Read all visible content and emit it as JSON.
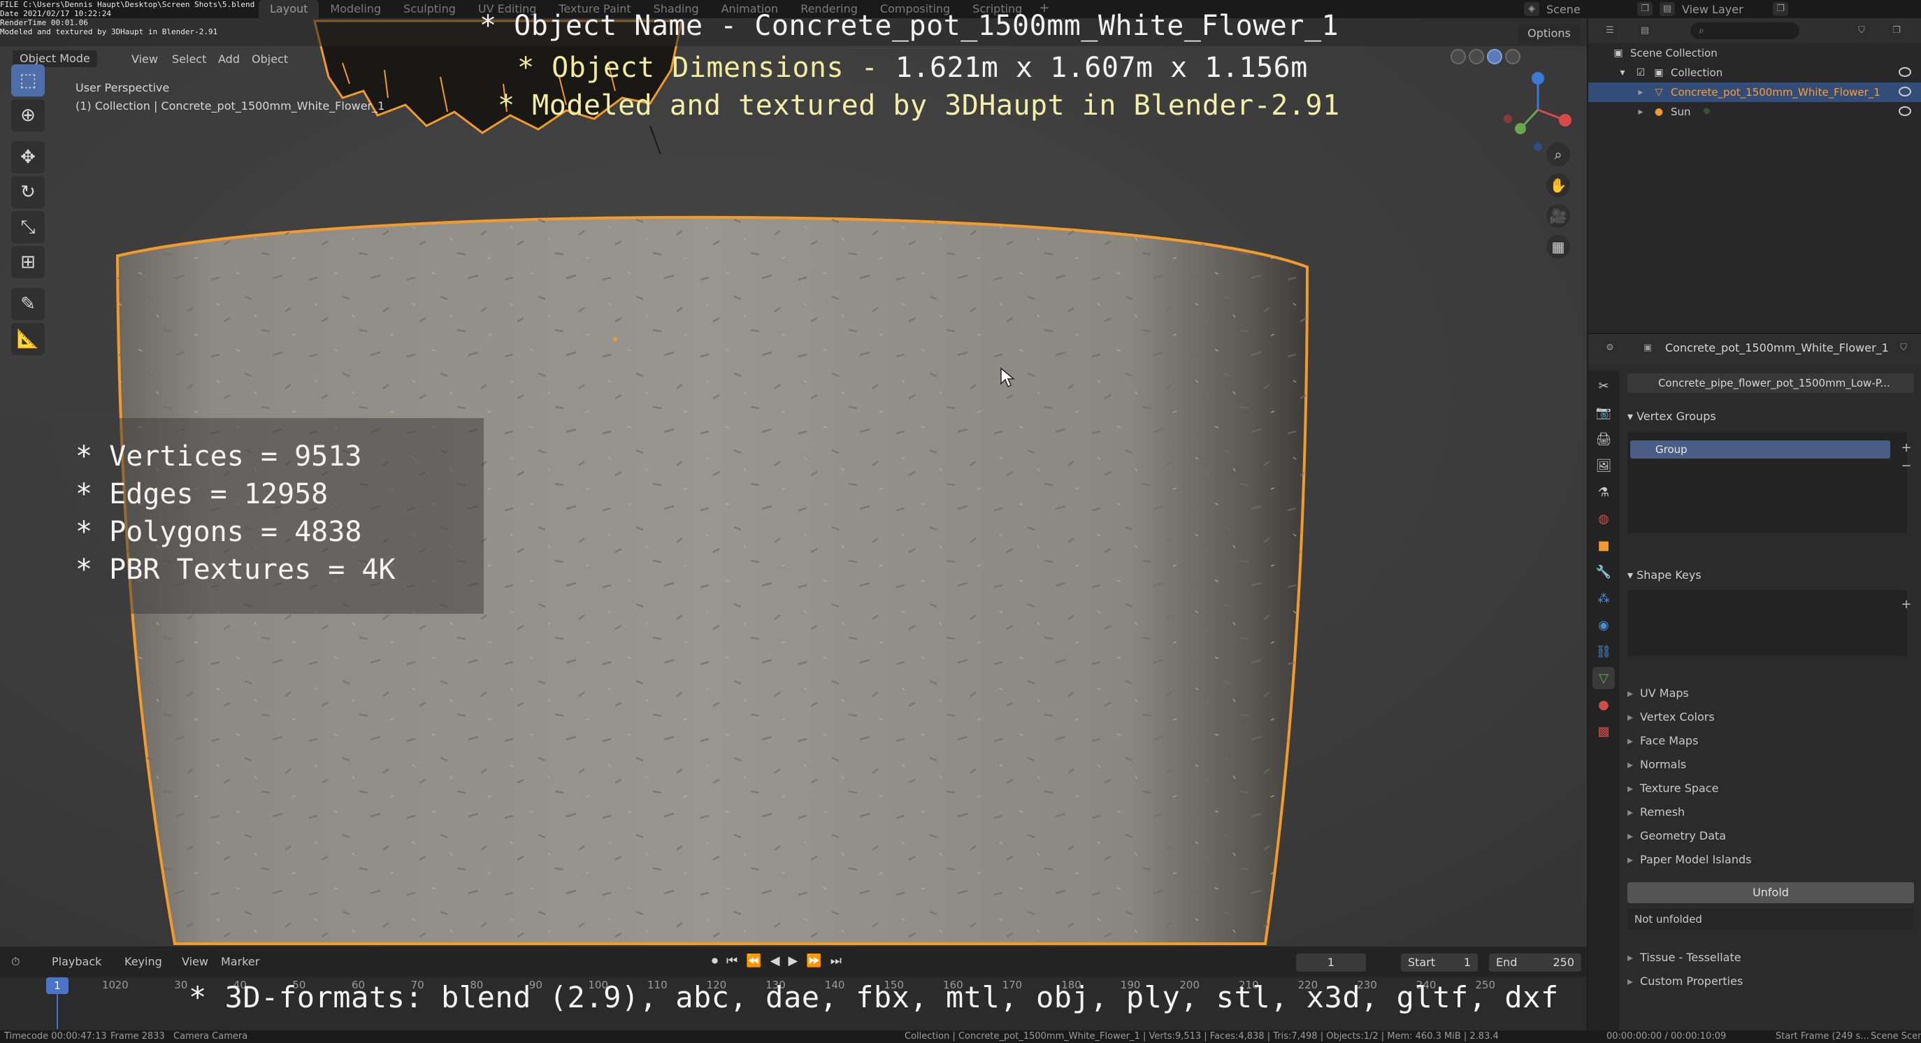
{
  "file_info": [
    "FILE C:\\Users\\Dennis Haupt\\Desktop\\Screen Shots\\5.blend",
    "Date 2021/02/17 10:22:24",
    "RenderTime 00:01.06",
    "Modeled and textured by 3DHaupt in Blender-2.91"
  ],
  "workspace_tabs": [
    "Layout",
    "Modeling",
    "Sculpting",
    "UV Editing",
    "Texture Paint",
    "Shading",
    "Animation",
    "Rendering",
    "Compositing",
    "Scripting"
  ],
  "active_tab": "Layout",
  "add_workspace": "+",
  "scene_label": "Scene",
  "view_layer_label": "View Layer",
  "viewport": {
    "mode": "Object Mode",
    "menus": [
      "View",
      "Select",
      "Add",
      "Object"
    ],
    "options": "Options",
    "perspective": "User Perspective",
    "collection": "(1) Collection | Concrete_pot_1500mm_White_Flower_1"
  },
  "captions": {
    "name": "* Object Name - Concrete_pot_1500mm_White_Flower_1",
    "dims_prefix": "* Object Dimensions -",
    "dims_value": "1.621m x 1.607m x 1.156m",
    "modeled": "* Modeled and textured by 3DHaupt in Blender-2.91",
    "formats": "* 3D-formats: blend (2.9), abc, dae, fbx, mtl, obj, ply, stl, x3d, gltf, dxf"
  },
  "stats": [
    "* Vertices = 9513",
    "* Edges = 12958",
    "* Polygons = 4838",
    "* PBR Textures = 4K"
  ],
  "toolbar_icons": [
    "select-box-icon",
    "cursor-icon",
    "move-icon",
    "rotate-icon",
    "scale-icon",
    "transform-icon",
    "annotate-icon",
    "measure-icon"
  ],
  "timeline": {
    "menus": [
      "Playback",
      "Keying",
      "View",
      "Marker"
    ],
    "current_frame": "1",
    "start_label": "Start",
    "start": "1",
    "end_label": "End",
    "end": "250",
    "ruler": [
      "1",
      "10",
      "20",
      "30",
      "40",
      "50",
      "60",
      "70",
      "80",
      "90",
      "100",
      "110",
      "120",
      "130",
      "140",
      "150",
      "160",
      "170",
      "180",
      "190",
      "200",
      "210",
      "220",
      "230",
      "240",
      "250"
    ]
  },
  "statusbar": {
    "left": "Timecode 00:00:47:13",
    "frame": "Frame 2833",
    "camera": "Camera Camera",
    "stats": "Collection | Concrete_pot_1500mm_White_Flower_1 | Verts:9,513 | Faces:4,838 | Tris:7,498 | Objects:1/2 | Mem: 460.3 MiB | 2.83.4",
    "time": "00:00:00:00 / 00:00:10:09",
    "right": "Start Frame (249 s...",
    "scene": "Scene Scene"
  },
  "outliner": {
    "root": "Scene Collection",
    "collection": "Collection",
    "object": "Concrete_pot_1500mm_White_Flower_1",
    "sun": "Sun"
  },
  "properties": {
    "object_name": "Concrete_pot_1500mm_White_Flower_1",
    "mesh_name": "Concrete_pipe_flower_pot_1500mm_Low-P...",
    "vertex_groups": "Vertex Groups",
    "group_item": "Group",
    "shape_keys": "Shape Keys",
    "panels": [
      "UV Maps",
      "Vertex Colors",
      "Face Maps",
      "Normals",
      "Texture Space",
      "Remesh",
      "Geometry Data",
      "Paper Model Islands"
    ],
    "unfold": "Unfold",
    "not_unfolded": "Not unfolded",
    "more_panels": [
      "Tissue - Tessellate",
      "Custom Properties"
    ]
  },
  "colors": {
    "selection_outline": "#f39a2c",
    "accent_blue": "#4a74c9",
    "caption_yellow": "#f2ec9e"
  }
}
